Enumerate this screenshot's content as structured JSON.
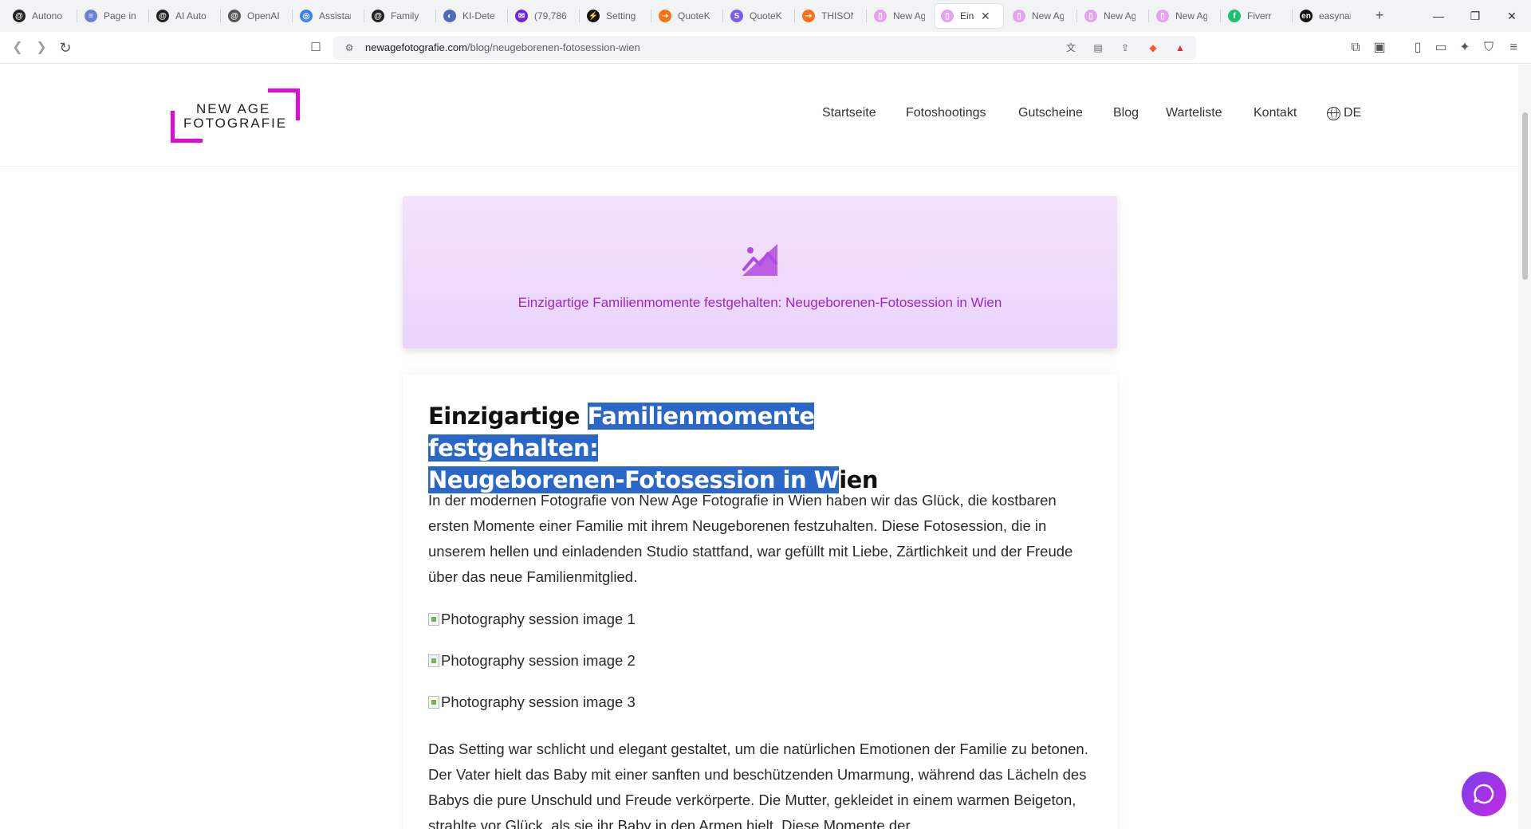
{
  "browser": {
    "tabs": [
      {
        "label": "Autono",
        "color": "#222222",
        "glyph": "@"
      },
      {
        "label": "Page in",
        "color": "#6b7fd7",
        "glyph": "≡"
      },
      {
        "label": "AI Auto",
        "color": "#222222",
        "glyph": "@"
      },
      {
        "label": "OpenAI",
        "color": "#555555",
        "glyph": "@"
      },
      {
        "label": "Assistan",
        "color": "#3b82f6",
        "glyph": "◎"
      },
      {
        "label": "Family",
        "color": "#222222",
        "glyph": "@"
      },
      {
        "label": "KI-Dete",
        "color": "#4b6cb7",
        "glyph": "◐"
      },
      {
        "label": "(79,786",
        "color": "#6d28d9",
        "glyph": "✉"
      },
      {
        "label": "Setting",
        "color": "#111111",
        "glyph": "⚡"
      },
      {
        "label": "QuoteK",
        "color": "#f97316",
        "glyph": "⇢"
      },
      {
        "label": "QuoteK",
        "color": "#7c5cf6",
        "glyph": "S"
      },
      {
        "label": "THISON",
        "color": "#f97316",
        "glyph": "⇢"
      },
      {
        "label": "New Ag",
        "color": "#e5a3ef",
        "glyph": "▯"
      },
      {
        "label": "Ein",
        "color": "#e5a3ef",
        "glyph": "▯",
        "active": true
      },
      {
        "label": "New Ag",
        "color": "#e5a3ef",
        "glyph": "▯"
      },
      {
        "label": "New Ag",
        "color": "#e5a3ef",
        "glyph": "▯"
      },
      {
        "label": "New Ag",
        "color": "#e5a3ef",
        "glyph": "▯"
      },
      {
        "label": "Fiverr",
        "color": "#1dbf73",
        "glyph": "f"
      },
      {
        "label": "easynai",
        "color": "#111111",
        "glyph": "en"
      }
    ],
    "url_domain": "newagefotografie.com",
    "url_path": "/blog/neugeborenen-fotosession-wien"
  },
  "site": {
    "logo_line1": "NEW AGE",
    "logo_line2": "FOTOGRAFIE",
    "nav": [
      "Startseite",
      "Fotoshootings",
      "Gutscheine",
      "Blog",
      "Warteliste",
      "Kontakt"
    ],
    "lang": "DE"
  },
  "hero": {
    "caption": "Einzigartige Familienmomente festgehalten: Neugeborenen-Fotosession in Wien"
  },
  "article": {
    "title_plain_start": "Einzigartige ",
    "title_sel_line1": "Familienmomente festgehalten:",
    "title_sel_line2": "Neugeborenen-Fotosession in W",
    "title_plain_end": "ien",
    "para1": "In der modernen Fotografie von New Age Fotografie in Wien haben wir das Glück, die kostbaren ersten Momente einer Familie mit ihrem Neugeborenen festzuhalten. Diese Fotosession, die in unserem hellen und einladenden Studio stattfand, war gefüllt mit Liebe, Zärtlichkeit und der Freude über das neue Familienmitglied.",
    "images": [
      "Photography session image 1",
      "Photography session image 2",
      "Photography session image 3"
    ],
    "para2": "Das Setting war schlicht und elegant gestaltet, um die natürlichen Emotionen der Familie zu betonen. Der Vater hielt das Baby mit einer sanften und beschützenden Umarmung, während das Lächeln des Babys die pure Unschuld und Freude verkörperte. Die Mutter, gekleidet in einem warmen Beigeton, strahlte vor Glück, als sie ihr Baby in den Armen hielt. Diese Momente der"
  }
}
